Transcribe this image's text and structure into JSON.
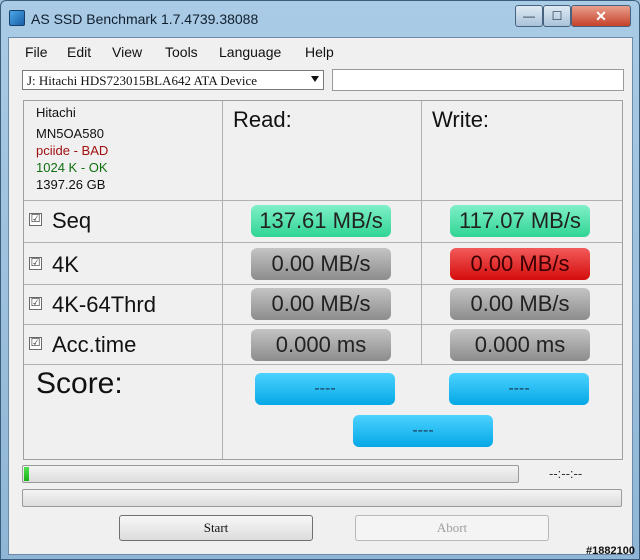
{
  "window": {
    "title": "AS SSD Benchmark 1.7.4739.38088",
    "minimize": "—",
    "maximize": "☐",
    "close": "✕"
  },
  "menu": [
    "File",
    "Edit",
    "View",
    "Tools",
    "Language",
    "Help"
  ],
  "device": {
    "selected": "J: Hitachi HDS723015BLA642 ATA Device"
  },
  "drive_info": {
    "brand": "Hitachi",
    "model": "MN5OA580",
    "driver": "pciide - BAD",
    "alignment": "1024 K - OK",
    "capacity": "1397.26 GB"
  },
  "columns": {
    "read": "Read:",
    "write": "Write:"
  },
  "rows": [
    {
      "label": "Seq",
      "checked": "☑",
      "read": "137.61 MB/s",
      "write": "117.07 MB/s"
    },
    {
      "label": "4K",
      "checked": "☑",
      "read": "0.00 MB/s",
      "write": "0.00 MB/s"
    },
    {
      "label": "4K-64Thrd",
      "checked": "☑",
      "read": "0.00 MB/s",
      "write": "0.00 MB/s"
    },
    {
      "label": "Acc.time",
      "checked": "☑",
      "read": "0.000 ms",
      "write": "0.000 ms"
    }
  ],
  "score": {
    "label": "Score:",
    "read": "----",
    "write": "----",
    "total": "----"
  },
  "progress": {
    "fraction": 0.01,
    "time": "--:--:--",
    "fraction2": 0.0
  },
  "buttons": {
    "start": "Start",
    "abort": "Abort"
  },
  "watermark": "#1882100",
  "colors": {
    "driver_bad": "#a01010",
    "alignment_ok": "#107010"
  }
}
